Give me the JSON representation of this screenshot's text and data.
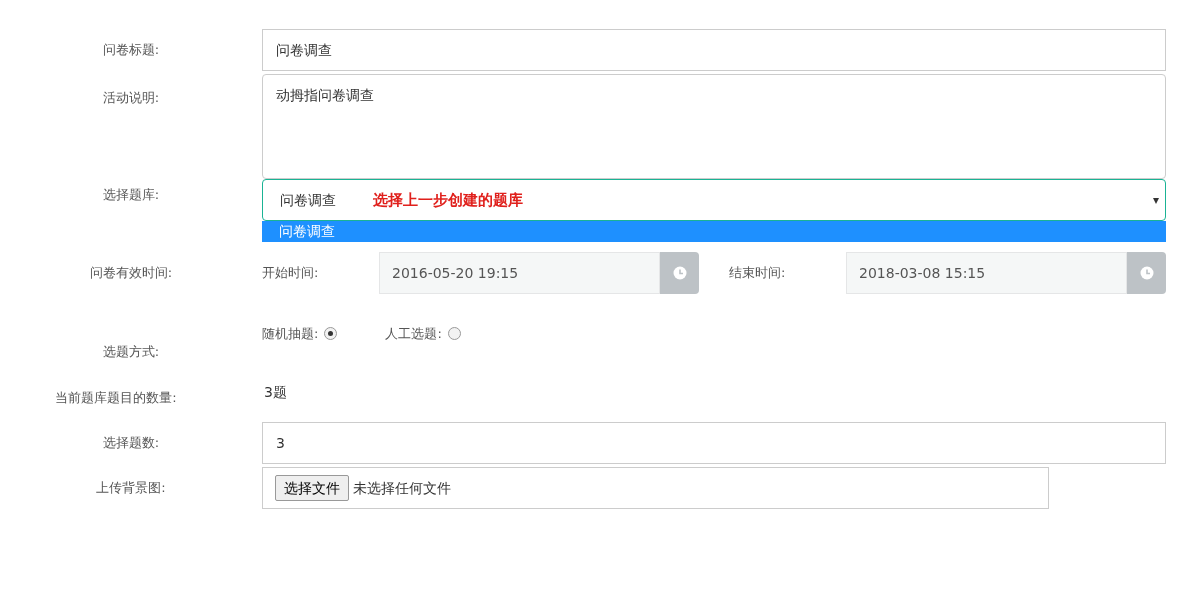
{
  "rows": [
    {
      "kind": "text",
      "label": "问卷标题:",
      "value": "问卷调查"
    },
    {
      "kind": "textarea",
      "label": "活动说明:",
      "value": "动拇指问卷调查"
    },
    {
      "kind": "select",
      "label": "选择题库:",
      "value": "问卷调查",
      "note": "选择上一步创建的题库",
      "caret": "▾",
      "options": [
        {
          "label": "问卷调查",
          "selected": true
        }
      ]
    },
    {
      "kind": "daterange",
      "label": "问卷有效时间:",
      "start_label": "开始时间:",
      "start": "2016-05-20 19:15",
      "end_label": "结束时间:",
      "end": "2018-03-08 15:15"
    },
    {
      "kind": "radio",
      "label": "选题方式:",
      "options": [
        {
          "label": "随机抽题:",
          "selected": true
        },
        {
          "label": "人工选题:",
          "selected": false
        }
      ]
    },
    {
      "kind": "static",
      "label": "当前题库题目的数量:",
      "value": "3题"
    },
    {
      "kind": "text",
      "label": "选择题数:",
      "value": "3"
    },
    {
      "kind": "file",
      "label": "上传背景图:",
      "button": "选择文件",
      "status": "未选择任何文件"
    }
  ]
}
